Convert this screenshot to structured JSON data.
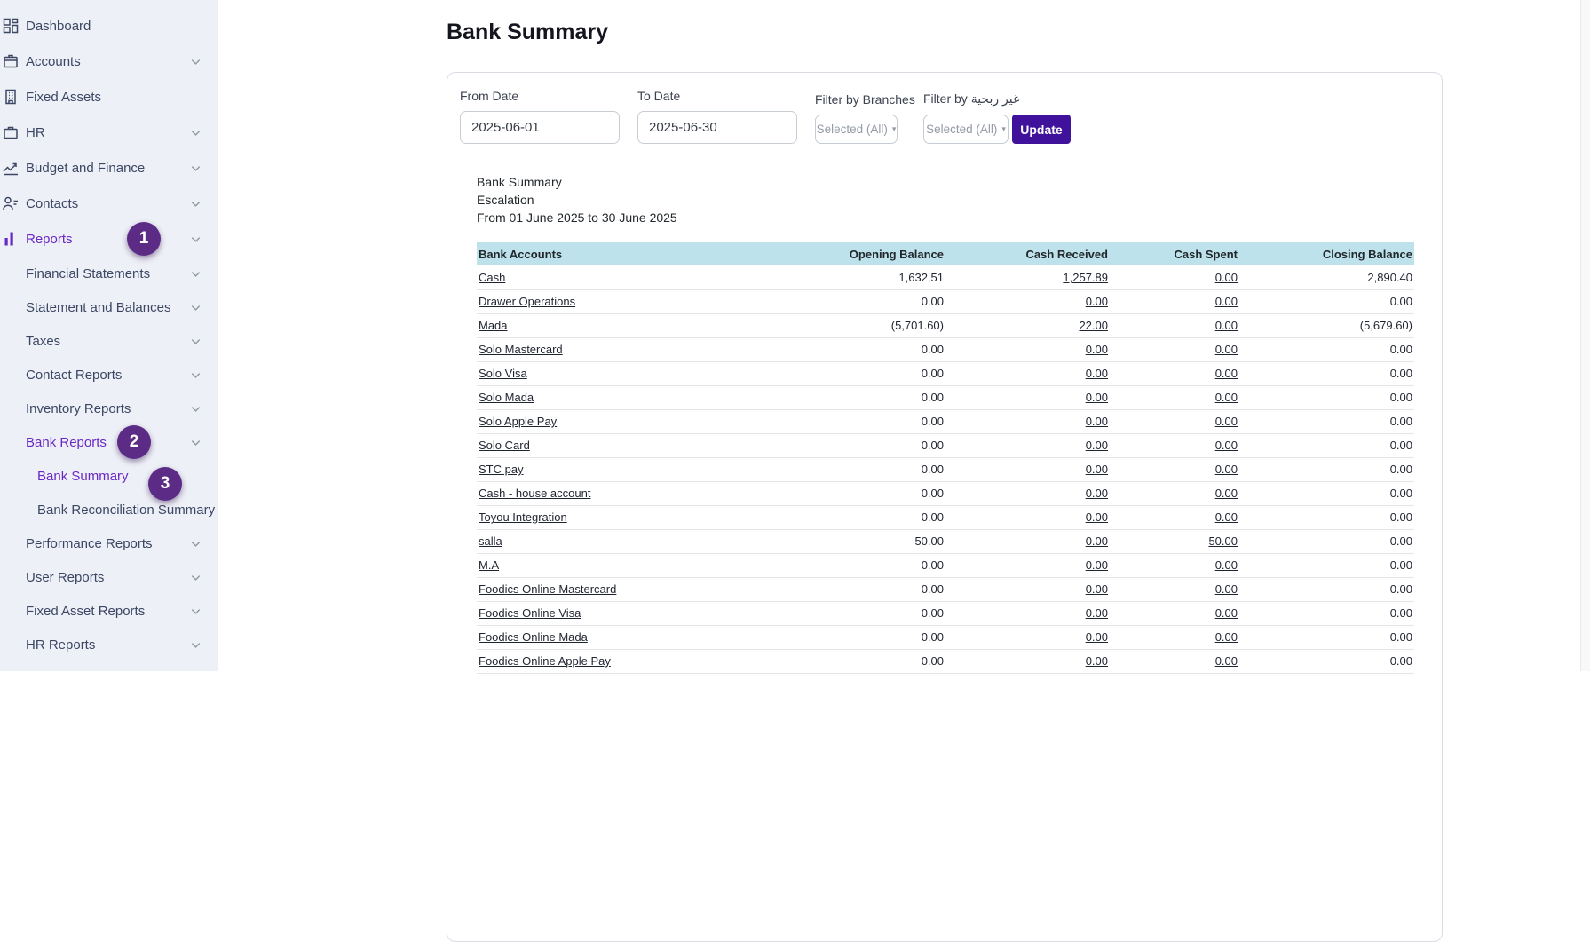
{
  "page": {
    "title": "Bank Summary"
  },
  "sidebar": {
    "items": [
      {
        "label": "Dashboard",
        "level": 0,
        "icon": "dashboard-icon",
        "chevron": false,
        "active": false,
        "badge": null
      },
      {
        "label": "Accounts",
        "level": 0,
        "icon": "accounts-icon",
        "chevron": true,
        "active": false,
        "badge": null
      },
      {
        "label": "Fixed Assets",
        "level": 0,
        "icon": "fixed-assets-icon",
        "chevron": false,
        "active": false,
        "badge": null
      },
      {
        "label": "HR",
        "level": 0,
        "icon": "hr-icon",
        "chevron": true,
        "active": false,
        "badge": null
      },
      {
        "label": "Budget and Finance",
        "level": 0,
        "icon": "budget-finance-icon",
        "chevron": true,
        "active": false,
        "badge": null
      },
      {
        "label": "Contacts",
        "level": 0,
        "icon": "contacts-icon",
        "chevron": true,
        "active": false,
        "badge": null
      },
      {
        "label": "Reports",
        "level": 0,
        "icon": "reports-icon",
        "chevron": true,
        "active": true,
        "badge": "1"
      },
      {
        "label": "Financial Statements",
        "level": 1,
        "icon": null,
        "chevron": true,
        "active": false,
        "badge": null
      },
      {
        "label": "Statement and Balances",
        "level": 1,
        "icon": null,
        "chevron": true,
        "active": false,
        "badge": null
      },
      {
        "label": "Taxes",
        "level": 1,
        "icon": null,
        "chevron": true,
        "active": false,
        "badge": null
      },
      {
        "label": "Contact Reports",
        "level": 1,
        "icon": null,
        "chevron": true,
        "active": false,
        "badge": null
      },
      {
        "label": "Inventory Reports",
        "level": 1,
        "icon": null,
        "chevron": true,
        "active": false,
        "badge": null
      },
      {
        "label": "Bank Reports",
        "level": 1,
        "icon": null,
        "chevron": true,
        "active": true,
        "badge": "2"
      },
      {
        "label": "Bank Summary",
        "level": 2,
        "icon": null,
        "chevron": false,
        "active": true,
        "badge": "3"
      },
      {
        "label": "Bank Reconciliation Summary",
        "level": 2,
        "icon": null,
        "chevron": false,
        "active": false,
        "badge": null
      },
      {
        "label": "Performance Reports",
        "level": 1,
        "icon": null,
        "chevron": true,
        "active": false,
        "badge": null
      },
      {
        "label": "User Reports",
        "level": 1,
        "icon": null,
        "chevron": true,
        "active": false,
        "badge": null
      },
      {
        "label": "Fixed Asset Reports",
        "level": 1,
        "icon": null,
        "chevron": true,
        "active": false,
        "badge": null
      },
      {
        "label": "HR Reports",
        "level": 1,
        "icon": null,
        "chevron": true,
        "active": false,
        "badge": null
      }
    ]
  },
  "filters": {
    "from_date": {
      "label": "From Date",
      "value": "2025-06-01"
    },
    "to_date": {
      "label": "To Date",
      "value": "2025-06-30"
    },
    "branches": {
      "label": "Filter by Branches",
      "value": "Selected (All)"
    },
    "tag": {
      "label": "Filter by غير ربحية",
      "value": "Selected (All)"
    },
    "update_label": "Update"
  },
  "report": {
    "title": "Bank Summary",
    "subtitle": "Escalation",
    "period": "From 01 June 2025 to 30 June 2025"
  },
  "table": {
    "columns": [
      "Bank Accounts",
      "Opening Balance",
      "Cash Received",
      "Cash Spent",
      "Closing Balance"
    ],
    "rows": [
      {
        "name": "Cash",
        "opening": "1,632.51",
        "received": "1,257.89",
        "spent": "0.00",
        "closing": "2,890.40"
      },
      {
        "name": "Drawer Operations",
        "opening": "0.00",
        "received": "0.00",
        "spent": "0.00",
        "closing": "0.00"
      },
      {
        "name": "Mada",
        "opening": "(5,701.60)",
        "received": "22.00",
        "spent": "0.00",
        "closing": "(5,679.60)"
      },
      {
        "name": "Solo Mastercard",
        "opening": "0.00",
        "received": "0.00",
        "spent": "0.00",
        "closing": "0.00"
      },
      {
        "name": "Solo Visa",
        "opening": "0.00",
        "received": "0.00",
        "spent": "0.00",
        "closing": "0.00"
      },
      {
        "name": "Solo Mada",
        "opening": "0.00",
        "received": "0.00",
        "spent": "0.00",
        "closing": "0.00"
      },
      {
        "name": "Solo Apple Pay",
        "opening": "0.00",
        "received": "0.00",
        "spent": "0.00",
        "closing": "0.00"
      },
      {
        "name": "Solo Card",
        "opening": "0.00",
        "received": "0.00",
        "spent": "0.00",
        "closing": "0.00"
      },
      {
        "name": "STC pay",
        "opening": "0.00",
        "received": "0.00",
        "spent": "0.00",
        "closing": "0.00"
      },
      {
        "name": "Cash - house account",
        "opening": "0.00",
        "received": "0.00",
        "spent": "0.00",
        "closing": "0.00"
      },
      {
        "name": "Toyou Integration",
        "opening": "0.00",
        "received": "0.00",
        "spent": "0.00",
        "closing": "0.00"
      },
      {
        "name": "salla",
        "opening": "50.00",
        "received": "0.00",
        "spent": "50.00",
        "closing": "0.00"
      },
      {
        "name": "M.A",
        "opening": "0.00",
        "received": "0.00",
        "spent": "0.00",
        "closing": "0.00"
      },
      {
        "name": "Foodics Online Mastercard",
        "opening": "0.00",
        "received": "0.00",
        "spent": "0.00",
        "closing": "0.00"
      },
      {
        "name": "Foodics Online Visa",
        "opening": "0.00",
        "received": "0.00",
        "spent": "0.00",
        "closing": "0.00"
      },
      {
        "name": "Foodics Online Mada",
        "opening": "0.00",
        "received": "0.00",
        "spent": "0.00",
        "closing": "0.00"
      },
      {
        "name": "Foodics Online Apple Pay",
        "opening": "0.00",
        "received": "0.00",
        "spent": "0.00",
        "closing": "0.00"
      }
    ]
  },
  "colors": {
    "accent_purple": "#6929c4",
    "badge_purple": "#5b2b85",
    "button_purple": "#40129b",
    "table_header_bg": "#bee2ec",
    "sidebar_bg": "#eef0f7"
  }
}
